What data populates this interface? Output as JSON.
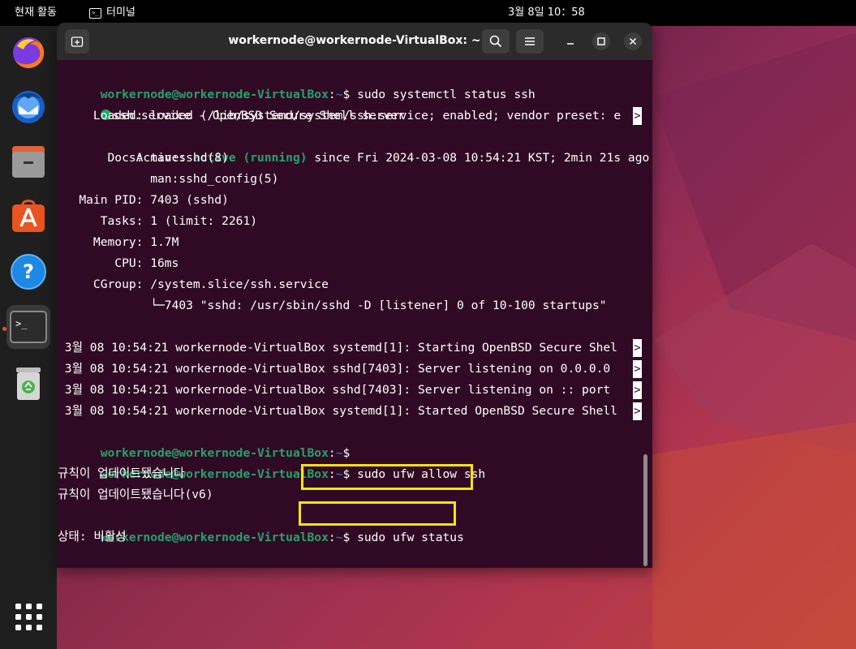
{
  "topbar": {
    "activities_label": "현재 활동",
    "terminal_app_label": "터미널",
    "clock": "3월 8일  10：58"
  },
  "dock": {
    "items": [
      {
        "name": "Firefox",
        "icon": "firefox-icon"
      },
      {
        "name": "Thunderbird",
        "icon": "thunderbird-icon"
      },
      {
        "name": "Files",
        "icon": "files-icon"
      },
      {
        "name": "Ubuntu Software",
        "icon": "software-center-icon"
      },
      {
        "name": "Help",
        "icon": "help-icon"
      },
      {
        "name": "Terminal",
        "icon": "terminal-icon"
      },
      {
        "name": "Trash",
        "icon": "trash-icon"
      }
    ],
    "show_apps_icon": "apps-grid-icon"
  },
  "window": {
    "title": "workernode@workernode-VirtualBox: ~"
  },
  "terminal": {
    "prompt_user": "workernode@workernode-VirtualBox",
    "prompt_sep": ":",
    "prompt_path": "~",
    "prompt_symbol": "$",
    "cmd1": " sudo systemctl status ssh",
    "service_line": "ssh.service - OpenBSD Secure Shell server",
    "loaded_line": "     Loaded: loaded (/lib/systemd/system/ssh.service; enabled; vendor preset: e",
    "active_label": "     Active: ",
    "active_value": "active (running)",
    "active_rest": " since Fri 2024-03-08 10:54:21 KST; 2min 21s ago",
    "docs_line": "       Docs: man:sshd(8)",
    "docs_line2": "             man:sshd_config(5)",
    "pid_line": "   Main PID: 7403 (sshd)",
    "tasks_line": "      Tasks: 1 (limit: 2261)",
    "memory_line": "     Memory: 1.7M",
    "cpu_line": "        CPU: 16ms",
    "cgroup_line": "     CGroup: /system.slice/ssh.service",
    "cgroup_child": "             └─7403 \"sshd: /usr/sbin/sshd -D [listener] 0 of 10-100 startups\"",
    "log1": " 3월 08 10:54:21 workernode-VirtualBox systemd[1]: Starting OpenBSD Secure Shel",
    "log2": " 3월 08 10:54:21 workernode-VirtualBox sshd[7403]: Server listening on 0.0.0.0 ",
    "log3": " 3월 08 10:54:21 workernode-VirtualBox sshd[7403]: Server listening on :: port ",
    "log4": " 3월 08 10:54:21 workernode-VirtualBox systemd[1]: Started OpenBSD Secure Shell",
    "truncation_marker": ">",
    "cmd2": " sudo ufw allow ssh",
    "out2a": "규칙이 업데이트됐습니다",
    "out2b": "규칙이 업데이트됐습니다(v6)",
    "cmd3": " sudo ufw status",
    "out3": "상태: 비활성"
  },
  "colors": {
    "terminal_bg": "#300a24",
    "prompt_user": "#26a269",
    "prompt_path": "#3465a4",
    "highlight_box": "#f5e50a",
    "ubuntu_orange": "#e95420"
  }
}
